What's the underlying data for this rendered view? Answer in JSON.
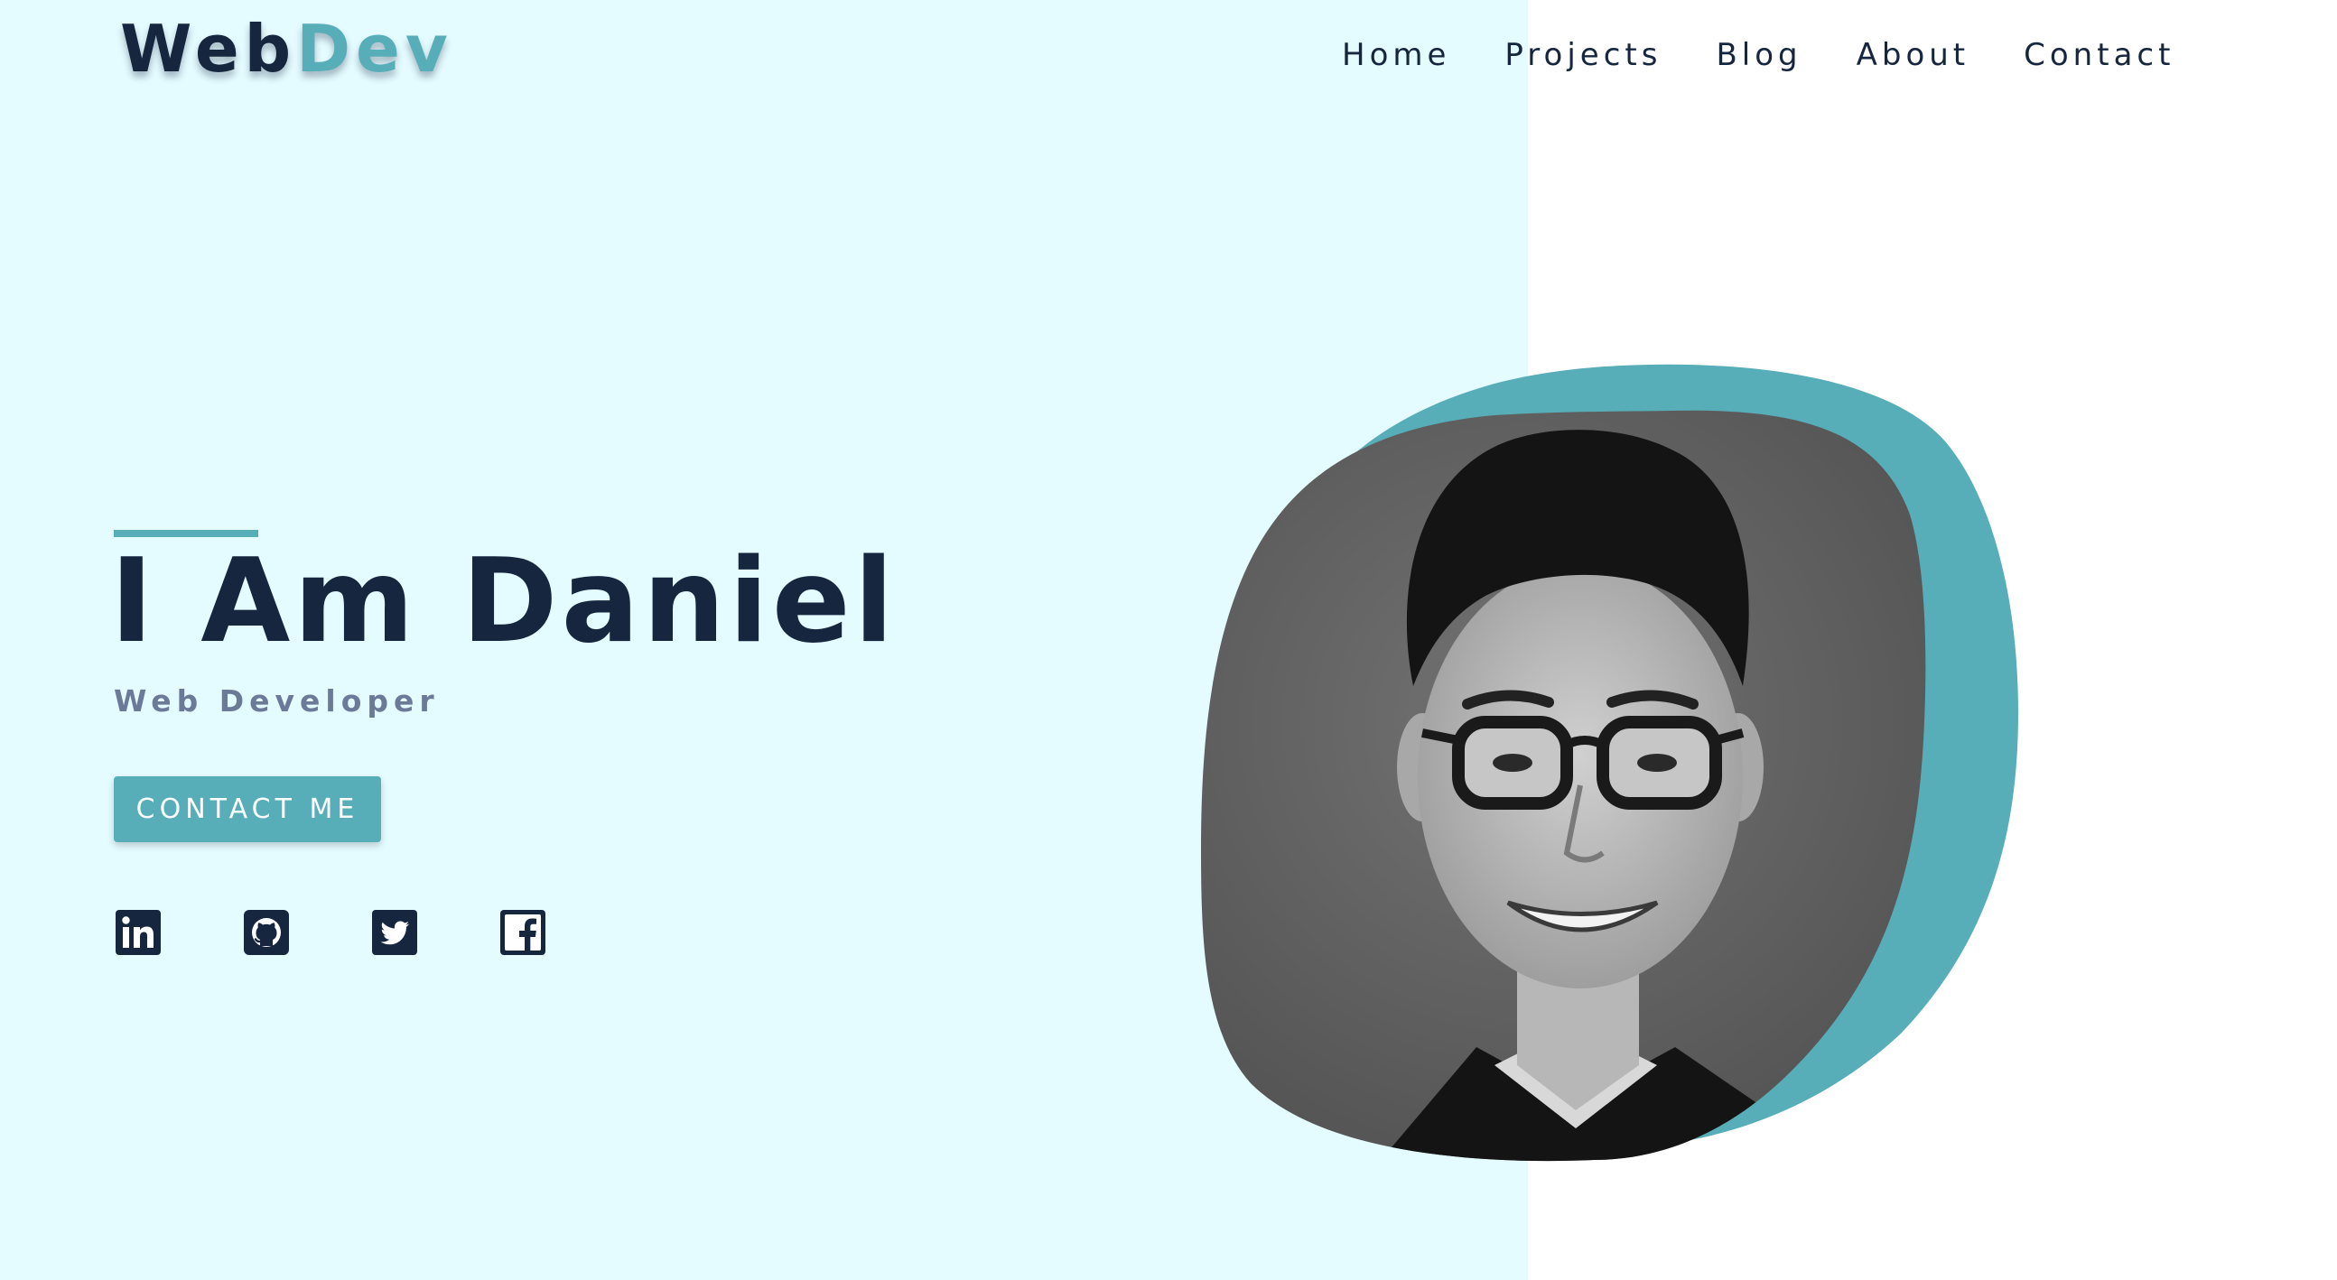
{
  "brand": {
    "part_a": "Web",
    "part_b": "Dev"
  },
  "nav": {
    "items": [
      "Home",
      "Projects",
      "Blog",
      "About",
      "Contact"
    ]
  },
  "hero": {
    "title": "I Am Daniel",
    "subtitle": "Web Developer",
    "cta_label": "CONTACT ME"
  },
  "social": {
    "icons": [
      "linkedin-icon",
      "github-icon",
      "twitter-icon",
      "facebook-icon"
    ]
  },
  "colors": {
    "background_left": "#e4fbff",
    "background_right": "#ffffff",
    "accent": "#57adb8",
    "navy": "#16263f",
    "subtitle": "#6b7a98"
  }
}
